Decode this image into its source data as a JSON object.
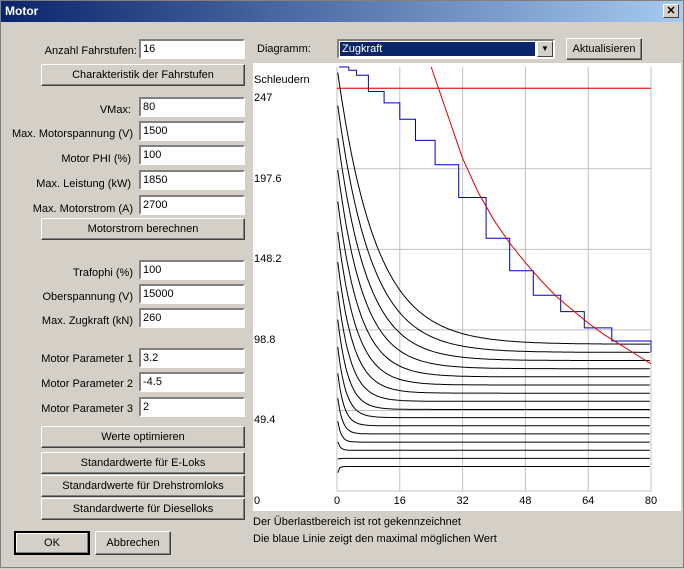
{
  "window": {
    "title": "Motor",
    "close_glyph": "✕"
  },
  "fields": [
    {
      "label": "Anzahl Fahrstufen:",
      "value": "16"
    },
    {
      "label": "VMax:",
      "value": "80"
    },
    {
      "label": "Max. Motorspannung (V)",
      "value": "1500"
    },
    {
      "label": "Motor PHI (%)",
      "value": "100"
    },
    {
      "label": "Max. Leistung (kW)",
      "value": "1850"
    },
    {
      "label": "Max. Motorstrom (A)",
      "value": "2700"
    },
    {
      "label": "Trafophi (%)",
      "value": "100"
    },
    {
      "label": "Oberspannung (V)",
      "value": "15000"
    },
    {
      "label": "Max. Zugkraft (kN)",
      "value": "260"
    },
    {
      "label": "Motor Parameter 1",
      "value": "3.2"
    },
    {
      "label": "Motor Parameter 2",
      "value": "-4.5"
    },
    {
      "label": "Motor Parameter 3",
      "value": "2"
    }
  ],
  "buttons": {
    "characteristic": "Charakteristik der Fahrstufen",
    "motor_current": "Motorstrom berechnen",
    "optimize": "Werte optimieren",
    "std_eloks": "Standardwerte für E-Loks",
    "std_drehstrom": "Standardwerte für Drehstromloks",
    "std_diesel": "Standardwerte für Dieselloks",
    "ok": "OK",
    "cancel": "Abbrechen",
    "refresh": "Aktualisieren"
  },
  "diagram": {
    "label": "Diagramm:",
    "selected": "Zugkraft",
    "arrow_glyph": "▼"
  },
  "notes": [
    "Der Überlastbereich ist rot gekennzeichnet",
    "Die blaue Linie zeigt den maximal möglichen Wert"
  ],
  "chart_data": {
    "type": "line",
    "ylabel": "Schleudern",
    "yticks": [
      "247",
      "197.6",
      "148.2",
      "98.8",
      "49.4",
      "0"
    ],
    "xticks": [
      "0",
      "16",
      "32",
      "48",
      "64",
      "80"
    ],
    "xlim": [
      0,
      80
    ],
    "ylim": [
      0,
      260
    ],
    "slip_limit": 247,
    "grid": true,
    "colors": {
      "steps": "#000000",
      "max_line": "#0000c0",
      "overload": "#e00000",
      "grid": "#c0c0c0"
    },
    "notch_count": 16,
    "overload_curve": {
      "x": [
        24,
        28,
        32,
        36,
        40,
        44,
        48,
        52,
        56,
        60,
        64,
        68,
        72,
        76,
        80
      ],
      "y": [
        260,
        232,
        204,
        183,
        166,
        152,
        140,
        129,
        119,
        111,
        103,
        96,
        90,
        84,
        78
      ]
    },
    "max_steps": {
      "x": [
        0.5,
        3,
        5,
        8,
        12,
        16,
        20,
        25,
        31,
        38,
        44,
        50,
        57,
        63,
        70,
        80
      ],
      "y": [
        260,
        258,
        255,
        245,
        238,
        228,
        215,
        200,
        180,
        155,
        135,
        120,
        110,
        100,
        92,
        85
      ]
    }
  }
}
